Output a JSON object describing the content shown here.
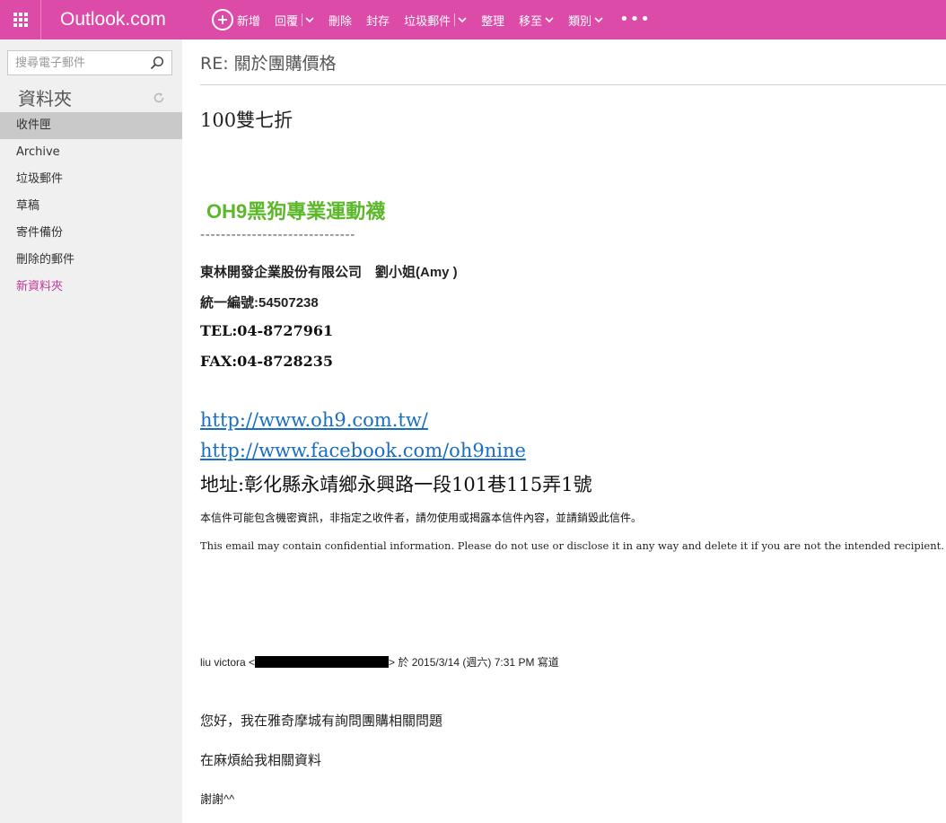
{
  "app": {
    "title": "Outlook.com"
  },
  "toolbar": {
    "new_label": "新增",
    "reply_label": "回覆",
    "delete_label": "刪除",
    "archive_label": "封存",
    "junk_label": "垃圾郵件",
    "sweep_label": "整理",
    "move_label": "移至",
    "category_label": "類別",
    "more_label": "•••"
  },
  "sidebar": {
    "search_placeholder": "搜尋電子郵件",
    "folders_title": "資料夾",
    "items": [
      {
        "label": "收件匣",
        "active": true
      },
      {
        "label": "Archive"
      },
      {
        "label": "垃圾郵件"
      },
      {
        "label": "草稿"
      },
      {
        "label": "寄件備份"
      },
      {
        "label": "刪除的郵件"
      },
      {
        "label": "新資料夾"
      }
    ]
  },
  "message": {
    "subject": "RE: 關於團購價格",
    "line1": "100雙七折",
    "brand": "OH9黑狗專業運動襪",
    "divider": "------------------------------",
    "company": "東林開發企業股份有限公司　劉小姐(Amy )",
    "tax_id": "統一編號:54507238",
    "tel": "TEL:04-8727961",
    "fax": "FAX:04-8728235",
    "url1": "http://www.oh9.com.tw/",
    "url2": "http://www.facebook.com/oh9nine",
    "address": "地址:彰化縣永靖鄉永興路一段101巷115弄1號",
    "disclaimer_zh": "本信件可能包含機密資訊，非指定之收件者，請勿使用或揭露本信件內容，並請銷毀此信件。",
    "disclaimer_en": "This email may contain confidential information. Please do not use or disclose it in any way and delete it if you are not the intended recipient.",
    "quote_from": "liu victora <",
    "quote_suffix": "> 於 2015/3/14 (週六) 7:31 PM 寫道",
    "quote_line1": "您好，我在雅奇摩城有詢問團購相關問題",
    "quote_line2": "在麻煩給我相關資料",
    "quote_line3": "謝謝^^"
  },
  "colors": {
    "topbar": "#dc4ba8",
    "brand_green": "#5cb82a",
    "link_blue": "#1a6ec0",
    "new_folder": "#c2389a"
  }
}
